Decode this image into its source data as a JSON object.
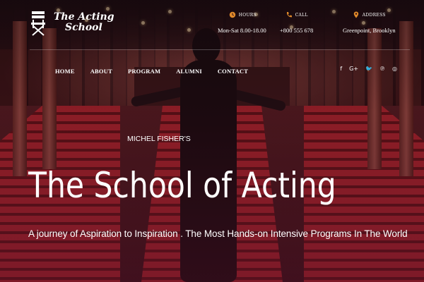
{
  "brand": {
    "line1": "The Acting",
    "line2": "School"
  },
  "info": [
    {
      "label": "HOURS",
      "value": "Mon-Sat 8.00-18.00",
      "icon": "clock-icon"
    },
    {
      "label": "CALL",
      "value": "+800 555 678",
      "icon": "phone-icon"
    },
    {
      "label": "ADDRESS",
      "value": "Greenpoint, Brooklyn",
      "icon": "location-pin-icon"
    }
  ],
  "nav": [
    "HOME",
    "ABOUT",
    "PROGRAM",
    "ALUMNI",
    "CONTACT"
  ],
  "social": [
    {
      "icon": "facebook-icon",
      "glyph": "f"
    },
    {
      "icon": "google-plus-icon",
      "glyph": "G+"
    },
    {
      "icon": "twitter-icon",
      "glyph": "🐦"
    },
    {
      "icon": "pinterest-icon",
      "glyph": "℗"
    },
    {
      "icon": "instagram-icon",
      "glyph": "◎"
    }
  ],
  "hero": {
    "kicker": "MICHEL FISHER'S",
    "title": "The School of Acting",
    "tagline": "A journey of Aspiration to Inspiration . The Most Hands-on Intensive Programs In The World"
  },
  "colors": {
    "accent": "#c0272f",
    "icon_accent": "#e08a2a"
  }
}
